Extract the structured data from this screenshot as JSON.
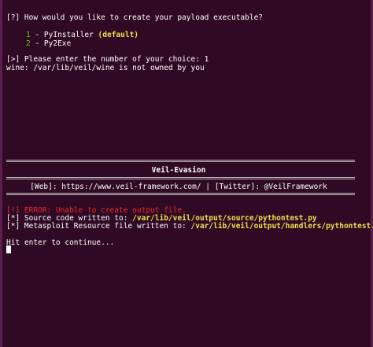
{
  "prompt": {
    "question": "[?] How would you like to create your payload executable?",
    "options": [
      {
        "num": "1",
        "sep": " - ",
        "label": "PyInstaller ",
        "tag": "(default)"
      },
      {
        "num": "2",
        "sep": " - ",
        "label": "Py2Exe",
        "tag": ""
      }
    ],
    "choice_line": "[>] Please enter the number of your choice: 1",
    "wine_warning": "wine: /var/lib/veil/wine is not owned by you"
  },
  "banner": {
    "title": "Veil-Evasion",
    "links": "[Web]: https://www.veil-framework.com/ | [Twitter]: @VeilFramework"
  },
  "output": {
    "error_prefix": "[!]",
    "error_text": " ERROR: Unable to create output file.",
    "source_prefix": "[*] Source code written to: ",
    "source_path": "/var/lib/veil/output/source/pythontest.py",
    "resource_prefix": "[*] Metasploit Resource file written to: ",
    "resource_path": "/var/lib/veil/output/handlers/pythontest.rc",
    "continue_text": "Hit enter to continue..."
  },
  "colors": {
    "background": "#300a24",
    "green": "#58d40b",
    "yellow": "#ece14e",
    "red": "#ef2929"
  }
}
